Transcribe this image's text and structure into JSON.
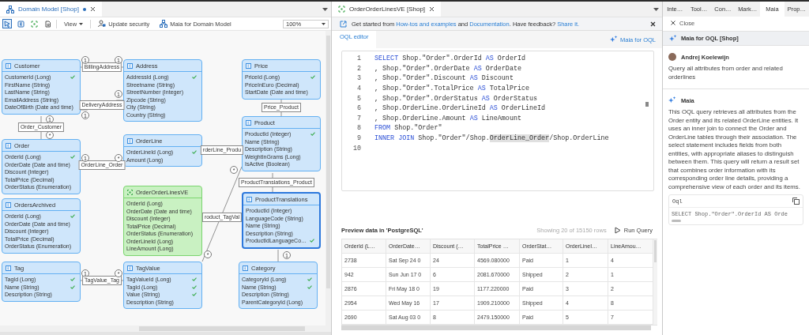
{
  "domain_model": {
    "tab": {
      "title": "Domain Model [Shop]",
      "modified": true
    },
    "toolbar": {
      "tools": [
        {
          "kind": "pointer",
          "selected": true
        },
        {
          "kind": "entity",
          "selected": false
        },
        {
          "kind": "view-entity",
          "selected": false
        },
        {
          "kind": "document",
          "selected": false
        }
      ],
      "view_menu": "View",
      "buttons": [
        "Update security",
        "Maia for Domain Model"
      ],
      "zoom": "100%"
    },
    "entities": [
      {
        "name": "Customer",
        "kind": "entity",
        "selected": false,
        "attributes": [
          {
            "name": "CustomerId (Long)",
            "checked": true
          },
          {
            "name": "FirstName (String)",
            "checked": false
          },
          {
            "name": "LastName (String)",
            "checked": false
          },
          {
            "name": "EmailAddress (String)",
            "checked": false
          },
          {
            "name": "DateOfBirth (Date and time)",
            "checked": false
          }
        ]
      },
      {
        "name": "Address",
        "kind": "entity",
        "selected": false,
        "attributes": [
          {
            "name": "AddressId (Long)",
            "checked": true
          },
          {
            "name": "Streetname (String)",
            "checked": false
          },
          {
            "name": "StreetNumber (Integer)",
            "checked": false
          },
          {
            "name": "Zipcode (String)",
            "checked": false
          },
          {
            "name": "City (String)",
            "checked": false
          },
          {
            "name": "Country (String)",
            "checked": false
          }
        ]
      },
      {
        "name": "Price",
        "kind": "entity",
        "selected": false,
        "attributes": [
          {
            "name": "PriceId (Long)",
            "checked": true
          },
          {
            "name": "PriceInEuro (Decimal)",
            "checked": false
          },
          {
            "name": "StartDate (Date and time)",
            "checked": false
          }
        ]
      },
      {
        "name": "Product",
        "kind": "entity",
        "selected": false,
        "attributes": [
          {
            "name": "ProductId (Integer)",
            "checked": true
          },
          {
            "name": "Name (String)",
            "checked": false
          },
          {
            "name": "Description (String)",
            "checked": false
          },
          {
            "name": "WeightInGrams (Long)",
            "checked": false
          },
          {
            "name": "IsActive (Boolean)",
            "checked": false
          }
        ]
      },
      {
        "name": "Order",
        "kind": "entity",
        "selected": false,
        "attributes": [
          {
            "name": "OrderId (Long)",
            "checked": true
          },
          {
            "name": "OrderDate (Date and time)",
            "checked": false
          },
          {
            "name": "Discount (Integer)",
            "checked": false
          },
          {
            "name": "TotalPrice (Decimal)",
            "checked": false
          },
          {
            "name": "OrderStatus (Enumeration)",
            "checked": false
          }
        ]
      },
      {
        "name": "OrderLine",
        "kind": "entity",
        "selected": false,
        "attributes": [
          {
            "name": "OrderLineId (Long)",
            "checked": true
          },
          {
            "name": "Amount (Long)",
            "checked": false
          }
        ]
      },
      {
        "name": "OrdersArchived",
        "kind": "entity",
        "selected": false,
        "attributes": [
          {
            "name": "OrderId (Long)",
            "checked": true
          },
          {
            "name": "OrderDate (Date and time)",
            "checked": false
          },
          {
            "name": "Discount (Integer)",
            "checked": false
          },
          {
            "name": "TotalPrice (Decimal)",
            "checked": false
          },
          {
            "name": "OrderStatus (Enumeration)",
            "checked": false
          }
        ]
      },
      {
        "name": "OrderOrderLinesVE",
        "kind": "view",
        "selected": false,
        "attributes": [
          {
            "name": "OrderId (Long)",
            "checked": false
          },
          {
            "name": "OrderDate (Date and time)",
            "checked": false
          },
          {
            "name": "Discount (Integer)",
            "checked": false
          },
          {
            "name": "TotalPrice (Decimal)",
            "checked": false
          },
          {
            "name": "OrderStatus (Enumeration)",
            "checked": false
          },
          {
            "name": "OrderLineId (Long)",
            "checked": false
          },
          {
            "name": "LineAmount (Long)",
            "checked": false
          }
        ]
      },
      {
        "name": "ProductTranslations",
        "kind": "entity",
        "selected": true,
        "attributes": [
          {
            "name": "ProductId (Integer)",
            "checked": false
          },
          {
            "name": "LanguageCode (String)",
            "checked": false
          },
          {
            "name": "Name (String)",
            "checked": false
          },
          {
            "name": "Description (String)",
            "checked": false
          },
          {
            "name": "ProductIdLanguageCo…",
            "checked": true
          }
        ]
      },
      {
        "name": "Tag",
        "kind": "entity",
        "selected": false,
        "attributes": [
          {
            "name": "TagId (Long)",
            "checked": true
          },
          {
            "name": "Name (String)",
            "checked": true
          },
          {
            "name": "Description (String)",
            "checked": false
          }
        ]
      },
      {
        "name": "TagValue",
        "kind": "entity",
        "selected": false,
        "attributes": [
          {
            "name": "TagValueId (Long)",
            "checked": true
          },
          {
            "name": "TagId (Long)",
            "checked": true
          },
          {
            "name": "Value (String)",
            "checked": true
          },
          {
            "name": "Description (String)",
            "checked": false
          }
        ]
      },
      {
        "name": "Category",
        "kind": "entity",
        "selected": false,
        "attributes": [
          {
            "name": "CategoryId (Long)",
            "checked": true
          },
          {
            "name": "Name (String)",
            "checked": true
          },
          {
            "name": "Description (String)",
            "checked": false
          },
          {
            "name": "ParentCategoryId (Long)",
            "checked": false
          }
        ]
      }
    ],
    "associations": [
      {
        "name": "BillingAddress",
        "ends": [
          "1",
          "1"
        ]
      },
      {
        "name": "DeliveryAddress",
        "ends": [
          "1",
          "1"
        ]
      },
      {
        "name": "Order_Customer",
        "ends": [
          "1",
          "*"
        ]
      },
      {
        "name": "OrderLine_Order",
        "ends": [
          "1",
          "*"
        ]
      },
      {
        "name": "rderLine_Produ"
      },
      {
        "name": "Price_Product"
      },
      {
        "name": "ProductTranslations_Product"
      },
      {
        "name": "roduct_TagVal",
        "ends": [
          "*",
          "*"
        ]
      },
      {
        "name": "TagValue_Tag",
        "ends": [
          "1",
          "*"
        ]
      },
      {
        "ends": [
          "1"
        ]
      }
    ]
  },
  "oql": {
    "tab": {
      "title": "OrderOrderLinesVE [Shop]"
    },
    "info_bar": [
      {
        "text": "Get started from ",
        "kind": "plain"
      },
      {
        "text": "How-tos and examples",
        "kind": "link"
      },
      {
        "text": " and ",
        "kind": "plain"
      },
      {
        "text": "Documentation",
        "kind": "link"
      },
      {
        "text": ". Have feedback? ",
        "kind": "plain"
      },
      {
        "text": "Share it.",
        "kind": "link"
      }
    ],
    "editor_tab": "OQL editor",
    "maia_button": "Maia for OQL",
    "code": [
      {
        "number": "1",
        "tokens": [
          {
            "text": "SELECT",
            "kind": "keyword"
          },
          {
            "text": " Shop.\"Order\".OrderId ",
            "kind": "plain"
          },
          {
            "text": "AS",
            "kind": "keyword"
          },
          {
            "text": " OrderId",
            "kind": "plain"
          }
        ]
      },
      {
        "number": "2",
        "tokens": [
          {
            "text": ", Shop.\"Order\".OrderDate ",
            "kind": "plain"
          },
          {
            "text": "AS",
            "kind": "keyword"
          },
          {
            "text": " OrderDate",
            "kind": "plain"
          }
        ]
      },
      {
        "number": "3",
        "tokens": [
          {
            "text": ", Shop.\"Order\".Discount ",
            "kind": "plain"
          },
          {
            "text": "AS",
            "kind": "keyword"
          },
          {
            "text": " Discount",
            "kind": "plain"
          }
        ]
      },
      {
        "number": "4",
        "tokens": [
          {
            "text": ", Shop.\"Order\".TotalPrice ",
            "kind": "plain"
          },
          {
            "text": "AS",
            "kind": "keyword"
          },
          {
            "text": " TotalPrice",
            "kind": "plain"
          }
        ]
      },
      {
        "number": "5",
        "tokens": [
          {
            "text": ", Shop.\"Order\".OrderStatus ",
            "kind": "plain"
          },
          {
            "text": "AS",
            "kind": "keyword"
          },
          {
            "text": " OrderStatus",
            "kind": "plain"
          }
        ]
      },
      {
        "number": "6",
        "tokens": [
          {
            "text": ", Shop.OrderLine.OrderLineId ",
            "kind": "plain"
          },
          {
            "text": "AS",
            "kind": "keyword"
          },
          {
            "text": " OrderLineId",
            "kind": "plain"
          }
        ]
      },
      {
        "number": "7",
        "tokens": [
          {
            "text": ", Shop.OrderLine.Amount ",
            "kind": "plain"
          },
          {
            "text": "AS",
            "kind": "keyword"
          },
          {
            "text": " LineAmount",
            "kind": "plain"
          }
        ]
      },
      {
        "number": "8",
        "tokens": [
          {
            "text": "FROM",
            "kind": "keyword"
          },
          {
            "text": " Shop.\"Order\"",
            "kind": "plain"
          }
        ]
      },
      {
        "number": "9",
        "tokens": [
          {
            "text": "INNER JOIN",
            "kind": "keyword"
          },
          {
            "text": " Shop.\"Order\"/Shop.",
            "kind": "plain"
          },
          {
            "text": "OrderLine_Order",
            "kind": "selected"
          },
          {
            "text": "/Shop.OrderLine",
            "kind": "plain"
          }
        ]
      },
      {
        "number": "10"
      }
    ],
    "preview": {
      "title": "Preview data in 'PostgreSQL'",
      "count": "Showing 20 of 15150 rows",
      "run_button": "Run Query",
      "columns": [
        "OrderId (L…",
        "OrderDate…",
        "Discount (…",
        "TotalPrice …",
        "OrderStat…",
        "OrderLineI…",
        "LineAmou…"
      ],
      "rows": [
        [
          "2738",
          "Sat Sep 24 0",
          "24",
          "4569.080000",
          "Paid",
          "1",
          "4"
        ],
        [
          "942",
          "Sun Jun 17 0",
          "6",
          "2081.670000",
          "Shipped",
          "2",
          "1"
        ],
        [
          "2876",
          "Fri May 18 0",
          "19",
          "1177.220000",
          "Paid",
          "3",
          "2"
        ],
        [
          "2954",
          "Wed May 16",
          "17",
          "1909.210000",
          "Shipped",
          "4",
          "8"
        ],
        [
          "2690",
          "Sat Aug 03 0",
          "8",
          "2479.150000",
          "Paid",
          "5",
          "7"
        ]
      ]
    }
  },
  "side_panel": {
    "tabs": [
      {
        "label": "Inte…",
        "selected": false
      },
      {
        "label": "Tool…",
        "selected": false
      },
      {
        "label": "Con…",
        "selected": false
      },
      {
        "label": "Mark…",
        "selected": false
      },
      {
        "label": "Maia",
        "selected": true
      },
      {
        "label": "Prop…",
        "selected": false
      }
    ],
    "close": "Close",
    "title": "Maia for OQL [Shop]",
    "user": {
      "name": "Andrej Koelewijn",
      "message": "Query all attributes from order and related orderlines"
    },
    "reply": {
      "author": "Maia",
      "text": "This OQL query retrieves all attributes from the Order entity and its related OrderLine entities. It uses an inner join to connect the Order and OrderLine tables through their association. The select statement includes fields from both entities, with appropriate aliases to distinguish between them. This query will return a result set that combines order information with its corresponding order line details, providing a comprehensive view of each order and its items.",
      "code": {
        "language": "Oql",
        "text": "SELECT Shop.\"Order\".OrderId AS Orde"
      }
    }
  }
}
